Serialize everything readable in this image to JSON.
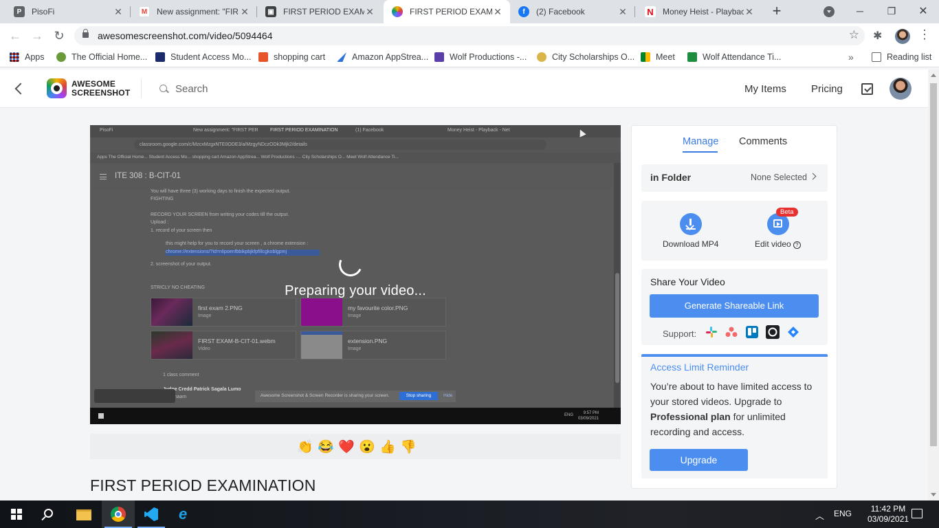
{
  "browser": {
    "tabs": [
      {
        "title": "PisoFi",
        "icon": "pisofi-icon",
        "color": "#5f6368"
      },
      {
        "title": "New assignment: \"FIRS",
        "icon": "gmail-icon",
        "color": "#ea4335"
      },
      {
        "title": "FIRST PERIOD EXAMIN",
        "icon": "classroom-icon",
        "color": "#3c4043"
      },
      {
        "title": "FIRST PERIOD EXAMIN",
        "icon": "awesome-screenshot-icon",
        "color": "#a142f4"
      },
      {
        "title": "(2) Facebook",
        "icon": "facebook-icon",
        "color": "#1877f2"
      },
      {
        "title": "Money Heist - Playbac",
        "icon": "netflix-icon",
        "color": "#e50914"
      }
    ],
    "active_tab_index": 3,
    "url": "awesomescreenshot.com/video/5094464",
    "bookmarks": [
      {
        "label": "Apps",
        "icon": "apps-grid-icon"
      },
      {
        "label": "The Official Home...",
        "icon": "official-home-icon"
      },
      {
        "label": "Student Access Mo...",
        "icon": "student-access-icon"
      },
      {
        "label": "shopping cart",
        "icon": "shopping-bag-icon"
      },
      {
        "label": "Amazon AppStrea...",
        "icon": "amazon-appstream-icon"
      },
      {
        "label": "Wolf Productions -...",
        "icon": "wolf-productions-icon"
      },
      {
        "label": "City Scholarships O...",
        "icon": "city-scholarships-icon"
      },
      {
        "label": "Meet",
        "icon": "meet-icon"
      },
      {
        "label": "Wolf Attendance Ti...",
        "icon": "attendance-icon"
      }
    ],
    "reading_list": "Reading list"
  },
  "site": {
    "logo_line1": "AWESOME",
    "logo_line2": "SCREENSHOT",
    "search_placeholder": "Search",
    "nav": {
      "my_items": "My Items",
      "pricing": "Pricing"
    }
  },
  "video": {
    "status": "Preparing your video...",
    "recorded": {
      "tabs": [
        "PisoFi",
        "New assignment: \"FIRST PER",
        "FIRST PERIOD EXAMINATION",
        "(1) Facebook",
        "Money Heist - Playback - Net"
      ],
      "url": "classroom.google.com/c/MzcxMzgxNTE0ODE3/a/MzgyNDczODk3Mjk2/details",
      "bookmarks": "Apps    The Official Home...    Student Access Mo...    shopping cart    Amazon AppStrea...    Wolf Productions -...    City Scholarships O...    Meet    Wolf Attendance Ti...",
      "course": "ITE 308 : B-CIT-01",
      "lines": [
        "You will have three (3) working days to finish the expected output.",
        "FIGHTING",
        "RECORD YOUR SCREEN from writing your codes till the output.",
        "Upload :",
        "1. record of your screen then",
        "this might help for you to record your screen , a chrome extension :",
        "chrome://extensions/?id=nlipoenfbbikpbjkfpfillcgkoblgpmj",
        "2. screenshot of your output.",
        "STRICLY NO CHEATING"
      ],
      "attachments": [
        {
          "name": "first exam 2.PNG",
          "type": "Image"
        },
        {
          "name": "my favourite color.PNG",
          "type": "Image"
        },
        {
          "name": "FIRST EXAM-B-CIT-01.webm",
          "type": "Video"
        },
        {
          "name": "extension.PNG",
          "type": "Image"
        }
      ],
      "comments": "1 class comment",
      "commenter": "Judge Credd Patrick Sagala Lumo",
      "comment_text": "sige maam",
      "sharing_text": "Awesome Screenshot & Screen Recorder is sharing your screen.",
      "stop_sharing": "Stop sharing",
      "hide": "Hide",
      "clock_time": "9:57 PM",
      "clock_date": "03/09/2021",
      "lang": "ENG"
    }
  },
  "reactions": [
    "👏",
    "😂",
    "❤️",
    "😮",
    "👍",
    "👎"
  ],
  "page_title": "FIRST PERIOD EXAMINATION",
  "panel": {
    "tabs": {
      "manage": "Manage",
      "comments": "Comments"
    },
    "folder_label": "in Folder",
    "folder_value": "None Selected",
    "download_label": "Download MP4",
    "edit_label": "Edit video",
    "beta": "Beta",
    "share_title": "Share Your Video",
    "generate_button": "Generate Shareable Link",
    "support_label": "Support:",
    "support_icons": [
      "slack-icon",
      "asana-icon",
      "trello-icon",
      "github-icon",
      "jira-icon"
    ],
    "access_title": "Access Limit Reminder",
    "access_text_1": "You’re about to have limited access to your stored videos. Upgrade to ",
    "access_bold": "Professional plan",
    "access_text_2": " for unlimited recording and access.",
    "upgrade_button": "Upgrade",
    "accent_color": "#4b8ef0"
  },
  "taskbar": {
    "lang": "ENG",
    "time": "11:42 PM",
    "date": "03/09/2021",
    "apps": [
      "file-explorer-icon",
      "chrome-icon",
      "vscode-icon",
      "internet-explorer-icon"
    ]
  }
}
